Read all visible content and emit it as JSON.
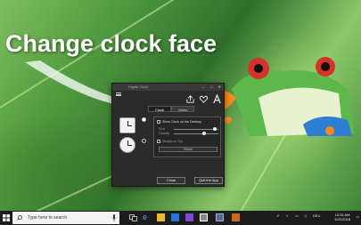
{
  "headline": "Change clock face",
  "window": {
    "title": "Digital Clock",
    "minimize": "–",
    "maximize": "□",
    "close": "✕",
    "tabs": [
      "Clock",
      "Alarm"
    ],
    "settings": {
      "show_on_desktop": "Show Clock on the Desktop",
      "size_label": "Size",
      "opacity_label": "Opacity",
      "always_on_top": "Always on Top",
      "reset_label": "Reset"
    },
    "close_button": "Close",
    "quit_button": "Quit the App"
  },
  "taskbar": {
    "search_placeholder": "Type here to search",
    "language": "DEU",
    "time": "10:31 AM",
    "date": "10/1/2018"
  },
  "colors": {
    "accent_blue": "#1e88e5",
    "window_bg": "#2b2b2b",
    "taskbar_bg": "#1c1c1c"
  }
}
